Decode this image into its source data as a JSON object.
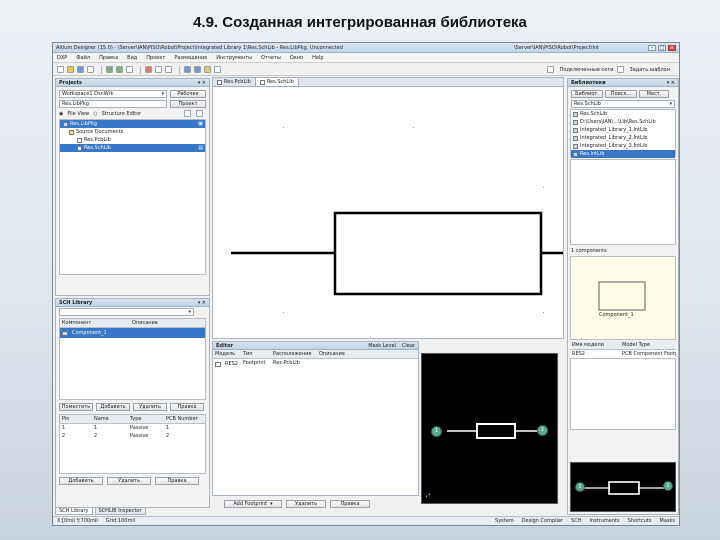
{
  "slide_title": "4.9. Созданная интегрированная библиотека",
  "window": {
    "title": "Altium Designer (15.0) - \\Server\\IAN\\PISO\\Robot\\Project\\Integrated Library 1\\Res.SchLib - Res.LibPkg. Unconnected",
    "path_right": "\\Server\\IAN\\PISO\\Robot\\Project\\Int"
  },
  "menu": [
    "DXP",
    "Файл",
    "Правка",
    "Вид",
    "Проект",
    "Размещение",
    "Инструменты",
    "Отчеты",
    "Окно",
    "Help"
  ],
  "toolbar": {
    "right_items": [
      "Подключенные сети",
      "Задать шаблон"
    ]
  },
  "projects_panel": {
    "title": "Projects",
    "workspace_select": "Workspace1.DsnWrk",
    "workspace_btn": "Рабочее",
    "project_field": "Res.LibPkg",
    "project_btn": "Проект",
    "view_file": "File View",
    "view_structure": "Structure Editor",
    "tree": [
      {
        "label": "Res.LibPkg",
        "level": 0,
        "selected": true
      },
      {
        "label": "Source Documents",
        "level": 1,
        "selected": false
      },
      {
        "label": "Res.PcbLib",
        "level": 2,
        "selected": false
      },
      {
        "label": "Res.SchLib",
        "level": 2,
        "selected": true
      }
    ]
  },
  "schlib_panel": {
    "title": "SCH Library",
    "col_component": "Компонент",
    "col_description": "Описание",
    "component": "Component_1",
    "btn_place": "Поместить",
    "btn_add": "Добавить",
    "btn_delete": "Удалить",
    "btn_edit": "Правка",
    "pins_headers": [
      "Pin",
      "Name",
      "Type",
      "PCB Number"
    ],
    "pins": [
      {
        "pin": "1",
        "name": "1",
        "type": "Passive",
        "num": "1"
      },
      {
        "pin": "2",
        "name": "2",
        "type": "Passive",
        "num": "2"
      }
    ],
    "btn_add2": "Добавить",
    "btn_delete2": "Удалить",
    "btn_edit2": "Правка"
  },
  "doc_tabs": [
    "Res.PcbLib",
    "Res.SchLib"
  ],
  "editor": {
    "title": "Editor",
    "mask_btn": "Mask Level",
    "clear_btn": "Clear",
    "headers": [
      "Модель",
      "Тип",
      "Расположение",
      "Описание"
    ],
    "rows": [
      {
        "model": "RES2",
        "type": "Footprint",
        "location": "Res.PcbLib",
        "desc": ""
      }
    ],
    "add_footprint": "Add Footprint",
    "btn_remove": "Удалить",
    "btn_edit": "Правка"
  },
  "library_panel": {
    "title": "Библиотеки",
    "btn_libraries": "Библиот.",
    "btn_search": "Поиск...",
    "btn_place": "Мест.",
    "current_lib": "Res.SchLib",
    "dropdown": [
      "Res.SchLib",
      "D:\\Users\\IAN\\...\\Lib\\Res.SchLib",
      "Integrated_Library_1.IntLib",
      "Integrated_Library_2.IntLib",
      "Integrated_Library_3.IntLib",
      "Res.IntLib"
    ],
    "components_count": "1 components",
    "model_headers": [
      "Имя модели",
      "Model Type"
    ],
    "model_row": {
      "name": "RES2",
      "type": "PCB Component Footprint"
    },
    "sheet_label": "Component_1"
  },
  "bottom_tabs": [
    "SCH Library",
    "SCHLIB Inspector"
  ],
  "status": {
    "left": "X:[0mil Y:700mil",
    "grid": "Grid:100mil",
    "right": [
      "System",
      "Design Compiler",
      "SCH",
      "Instruments",
      "Shortcuts",
      "Masks"
    ]
  }
}
